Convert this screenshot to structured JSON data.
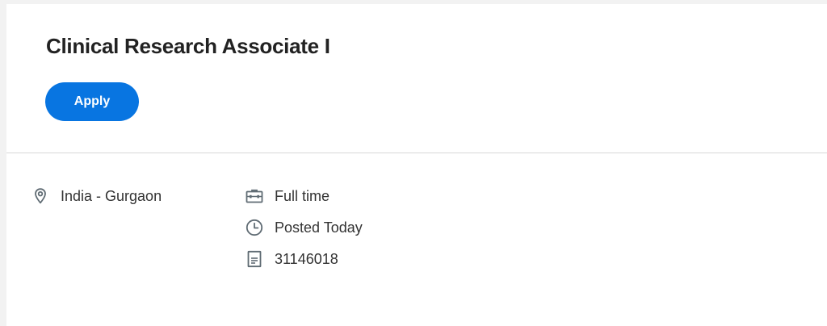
{
  "job": {
    "title": "Clinical Research Associate I",
    "apply_label": "Apply"
  },
  "details": {
    "location": {
      "icon": "location-pin-icon",
      "text": "India - Gurgaon"
    },
    "time_type": {
      "icon": "briefcase-icon",
      "text": "Full time"
    },
    "posted": {
      "icon": "clock-icon",
      "text": "Posted Today"
    },
    "requisition_id": {
      "icon": "document-icon",
      "text": "31146018"
    }
  },
  "colors": {
    "accent": "#0875e1",
    "title_text": "#222222",
    "body_text": "#333333",
    "icon": "#5f6b73",
    "divider": "#d8d8d8"
  }
}
